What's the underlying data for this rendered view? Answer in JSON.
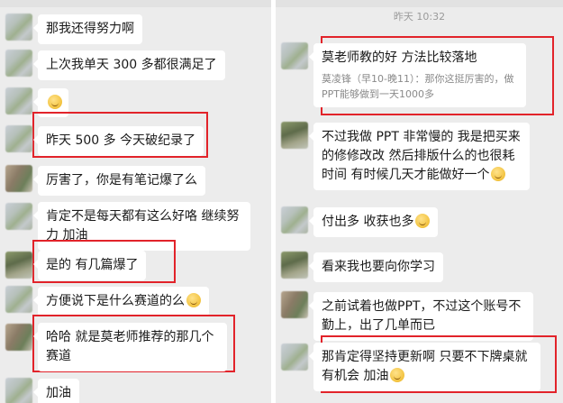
{
  "left": {
    "messages": [
      {
        "text": "那我还得努力啊"
      },
      {
        "text": "上次我单天 300 多都很满足了"
      },
      {
        "text": ""
      },
      {
        "text": "昨天 500 多  今天破纪录了"
      },
      {
        "text": "厉害了，你是有笔记爆了么"
      },
      {
        "text": "肯定不是每天都有这么好咯  继续努力  加油"
      },
      {
        "text": "是的 有几篇爆了"
      },
      {
        "text": "方便说下是什么赛道的么"
      },
      {
        "text": "哈哈 就是莫老师推荐的那几个赛道"
      },
      {
        "text": "加油"
      }
    ]
  },
  "right": {
    "timestamp": "昨天 10:32",
    "messages": [
      {
        "text": "莫老师教的好  方法比较落地",
        "quote": "莫凌锋（早10-晚11）：那你这挺厉害的，做PPT能够做到一天1000多"
      },
      {
        "text": "不过我做 PPT 非常慢的  我是把买来的修修改改  然后排版什么的也很耗时间  有时候几天才能做好一个"
      },
      {
        "text": "付出多 收获也多"
      },
      {
        "text": "看来我也要向你学习"
      },
      {
        "text": "之前试着也做PPT，不过这个账号不勤上，出了几单而已"
      },
      {
        "text": "那肯定得坚持更新啊  只要不下牌桌就有机会  加油"
      }
    ]
  },
  "colors": {
    "highlight": "#e2232a",
    "chat_bg": "#ececec",
    "bubble": "#ffffff"
  },
  "icons": [
    "emoji-face-icon"
  ]
}
